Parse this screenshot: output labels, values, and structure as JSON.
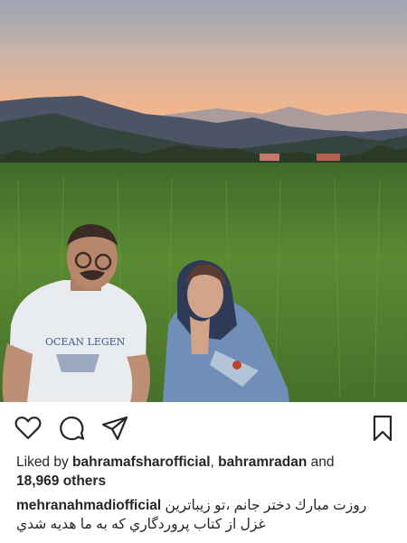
{
  "post": {
    "image_alt": "Two people sitting in a green rice field at sunset with mountains behind",
    "shirt_text": "OCEAN LEGEN"
  },
  "actions": {
    "like_icon": "heart-icon",
    "comment_icon": "comment-bubble-icon",
    "share_icon": "paper-plane-icon",
    "save_icon": "bookmark-icon"
  },
  "likes": {
    "prefix": "Liked by ",
    "user1": "bahramafsharofficial",
    "separator": ", ",
    "user2": "bahramradan",
    "conjunction": " and",
    "count": "18,969 others"
  },
  "caption": {
    "username": "mehranahmadiofficial",
    "line1": "روزت مبارك دختر جانم ،تو زيباترين",
    "line2": "غزل از كتاب پروردگاري كه به ما هديه شدي"
  },
  "colors": {
    "text": "#262626",
    "sky_top": "#9aa3b4",
    "sky_bottom": "#f4b98a",
    "field": "#4f7b2f"
  }
}
